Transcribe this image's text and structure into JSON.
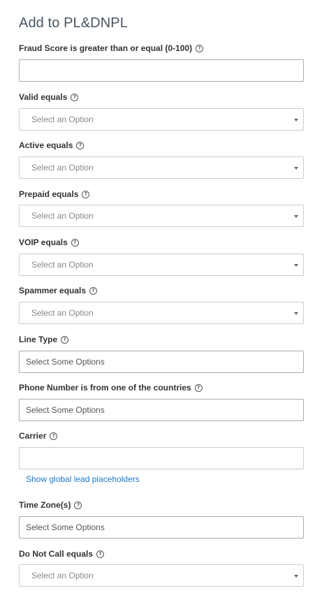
{
  "title": "Add to PL&DNPL",
  "help_glyph": "?",
  "fields": {
    "fraud_score": {
      "label": "Fraud Score is greater than or equal (0-100)",
      "value": ""
    },
    "valid": {
      "label": "Valid equals",
      "placeholder": "Select an Option"
    },
    "active": {
      "label": "Active equals",
      "placeholder": "Select an Option"
    },
    "prepaid": {
      "label": "Prepaid equals",
      "placeholder": "Select an Option"
    },
    "voip": {
      "label": "VOIP equals",
      "placeholder": "Select an Option"
    },
    "spammer": {
      "label": "Spammer equals",
      "placeholder": "Select an Option"
    },
    "line_type": {
      "label": "Line Type",
      "placeholder": "Select Some Options"
    },
    "countries": {
      "label": "Phone Number is from one of the countries",
      "placeholder": "Select Some Options"
    },
    "carrier": {
      "label": "Carrier",
      "value": ""
    },
    "time_zones": {
      "label": "Time Zone(s)",
      "placeholder": "Select Some Options"
    },
    "do_not_call": {
      "label": "Do Not Call equals",
      "placeholder": "Select an Option"
    }
  },
  "placeholders_link": "Show global lead placeholders"
}
